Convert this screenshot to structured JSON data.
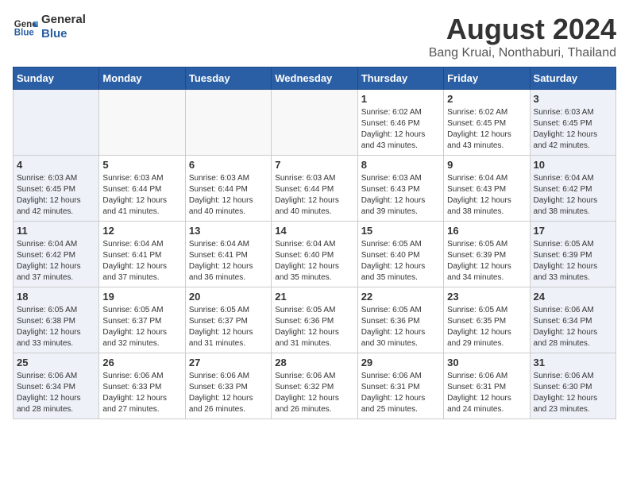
{
  "header": {
    "logo_line1": "General",
    "logo_line2": "Blue",
    "title": "August 2024",
    "subtitle": "Bang Kruai, Nonthaburi, Thailand"
  },
  "weekdays": [
    "Sunday",
    "Monday",
    "Tuesday",
    "Wednesday",
    "Thursday",
    "Friday",
    "Saturday"
  ],
  "weeks": [
    [
      {
        "day": "",
        "info": ""
      },
      {
        "day": "",
        "info": ""
      },
      {
        "day": "",
        "info": ""
      },
      {
        "day": "",
        "info": ""
      },
      {
        "day": "1",
        "info": "Sunrise: 6:02 AM\nSunset: 6:46 PM\nDaylight: 12 hours\nand 43 minutes."
      },
      {
        "day": "2",
        "info": "Sunrise: 6:02 AM\nSunset: 6:45 PM\nDaylight: 12 hours\nand 43 minutes."
      },
      {
        "day": "3",
        "info": "Sunrise: 6:03 AM\nSunset: 6:45 PM\nDaylight: 12 hours\nand 42 minutes."
      }
    ],
    [
      {
        "day": "4",
        "info": "Sunrise: 6:03 AM\nSunset: 6:45 PM\nDaylight: 12 hours\nand 42 minutes."
      },
      {
        "day": "5",
        "info": "Sunrise: 6:03 AM\nSunset: 6:44 PM\nDaylight: 12 hours\nand 41 minutes."
      },
      {
        "day": "6",
        "info": "Sunrise: 6:03 AM\nSunset: 6:44 PM\nDaylight: 12 hours\nand 40 minutes."
      },
      {
        "day": "7",
        "info": "Sunrise: 6:03 AM\nSunset: 6:44 PM\nDaylight: 12 hours\nand 40 minutes."
      },
      {
        "day": "8",
        "info": "Sunrise: 6:03 AM\nSunset: 6:43 PM\nDaylight: 12 hours\nand 39 minutes."
      },
      {
        "day": "9",
        "info": "Sunrise: 6:04 AM\nSunset: 6:43 PM\nDaylight: 12 hours\nand 38 minutes."
      },
      {
        "day": "10",
        "info": "Sunrise: 6:04 AM\nSunset: 6:42 PM\nDaylight: 12 hours\nand 38 minutes."
      }
    ],
    [
      {
        "day": "11",
        "info": "Sunrise: 6:04 AM\nSunset: 6:42 PM\nDaylight: 12 hours\nand 37 minutes."
      },
      {
        "day": "12",
        "info": "Sunrise: 6:04 AM\nSunset: 6:41 PM\nDaylight: 12 hours\nand 37 minutes."
      },
      {
        "day": "13",
        "info": "Sunrise: 6:04 AM\nSunset: 6:41 PM\nDaylight: 12 hours\nand 36 minutes."
      },
      {
        "day": "14",
        "info": "Sunrise: 6:04 AM\nSunset: 6:40 PM\nDaylight: 12 hours\nand 35 minutes."
      },
      {
        "day": "15",
        "info": "Sunrise: 6:05 AM\nSunset: 6:40 PM\nDaylight: 12 hours\nand 35 minutes."
      },
      {
        "day": "16",
        "info": "Sunrise: 6:05 AM\nSunset: 6:39 PM\nDaylight: 12 hours\nand 34 minutes."
      },
      {
        "day": "17",
        "info": "Sunrise: 6:05 AM\nSunset: 6:39 PM\nDaylight: 12 hours\nand 33 minutes."
      }
    ],
    [
      {
        "day": "18",
        "info": "Sunrise: 6:05 AM\nSunset: 6:38 PM\nDaylight: 12 hours\nand 33 minutes."
      },
      {
        "day": "19",
        "info": "Sunrise: 6:05 AM\nSunset: 6:37 PM\nDaylight: 12 hours\nand 32 minutes."
      },
      {
        "day": "20",
        "info": "Sunrise: 6:05 AM\nSunset: 6:37 PM\nDaylight: 12 hours\nand 31 minutes."
      },
      {
        "day": "21",
        "info": "Sunrise: 6:05 AM\nSunset: 6:36 PM\nDaylight: 12 hours\nand 31 minutes."
      },
      {
        "day": "22",
        "info": "Sunrise: 6:05 AM\nSunset: 6:36 PM\nDaylight: 12 hours\nand 30 minutes."
      },
      {
        "day": "23",
        "info": "Sunrise: 6:05 AM\nSunset: 6:35 PM\nDaylight: 12 hours\nand 29 minutes."
      },
      {
        "day": "24",
        "info": "Sunrise: 6:06 AM\nSunset: 6:34 PM\nDaylight: 12 hours\nand 28 minutes."
      }
    ],
    [
      {
        "day": "25",
        "info": "Sunrise: 6:06 AM\nSunset: 6:34 PM\nDaylight: 12 hours\nand 28 minutes."
      },
      {
        "day": "26",
        "info": "Sunrise: 6:06 AM\nSunset: 6:33 PM\nDaylight: 12 hours\nand 27 minutes."
      },
      {
        "day": "27",
        "info": "Sunrise: 6:06 AM\nSunset: 6:33 PM\nDaylight: 12 hours\nand 26 minutes."
      },
      {
        "day": "28",
        "info": "Sunrise: 6:06 AM\nSunset: 6:32 PM\nDaylight: 12 hours\nand 26 minutes."
      },
      {
        "day": "29",
        "info": "Sunrise: 6:06 AM\nSunset: 6:31 PM\nDaylight: 12 hours\nand 25 minutes."
      },
      {
        "day": "30",
        "info": "Sunrise: 6:06 AM\nSunset: 6:31 PM\nDaylight: 12 hours\nand 24 minutes."
      },
      {
        "day": "31",
        "info": "Sunrise: 6:06 AM\nSunset: 6:30 PM\nDaylight: 12 hours\nand 23 minutes."
      }
    ]
  ]
}
